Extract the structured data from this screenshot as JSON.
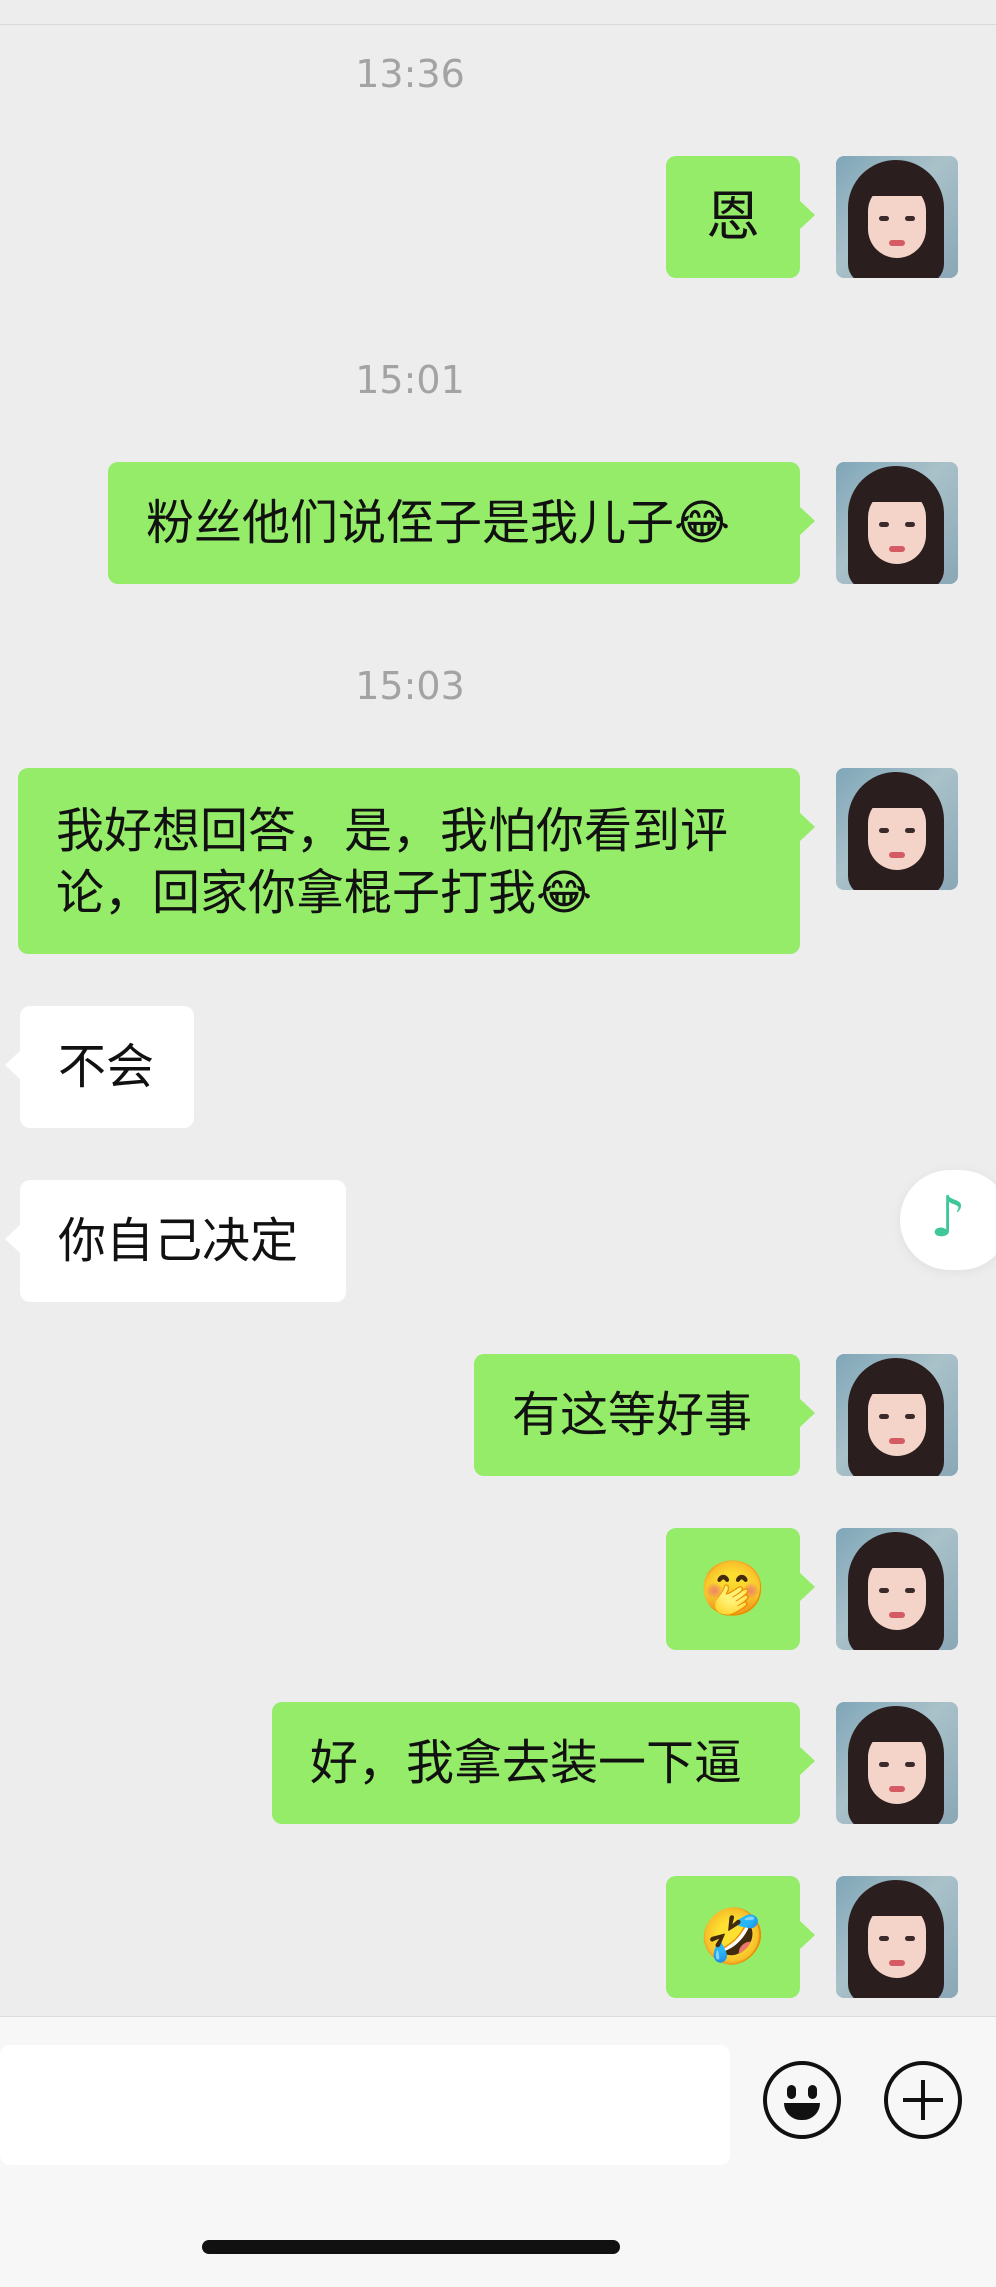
{
  "chat": {
    "timestamps": [
      "13:36",
      "15:01",
      "15:03"
    ],
    "messages": [
      {
        "dir": "out",
        "text": "恩"
      },
      {
        "dir": "out",
        "text": "粉丝他们说侄子是我儿子😂"
      },
      {
        "dir": "out",
        "text": "我好想回答，是，我怕你看到评论，回家你拿棍子打我😂"
      },
      {
        "dir": "in",
        "text": "不会"
      },
      {
        "dir": "in",
        "text": "你自己决定"
      },
      {
        "dir": "out",
        "text": "有这等好事"
      },
      {
        "dir": "out",
        "text": "🤭"
      },
      {
        "dir": "out",
        "text": "好，我拿去装一下逼"
      },
      {
        "dir": "out",
        "text": "🤣"
      }
    ]
  },
  "music_float": {
    "icon": "♪"
  },
  "input_bar": {
    "placeholder": "",
    "emoji_icon": "smiley-icon",
    "more_icon": "plus-circle-icon"
  }
}
